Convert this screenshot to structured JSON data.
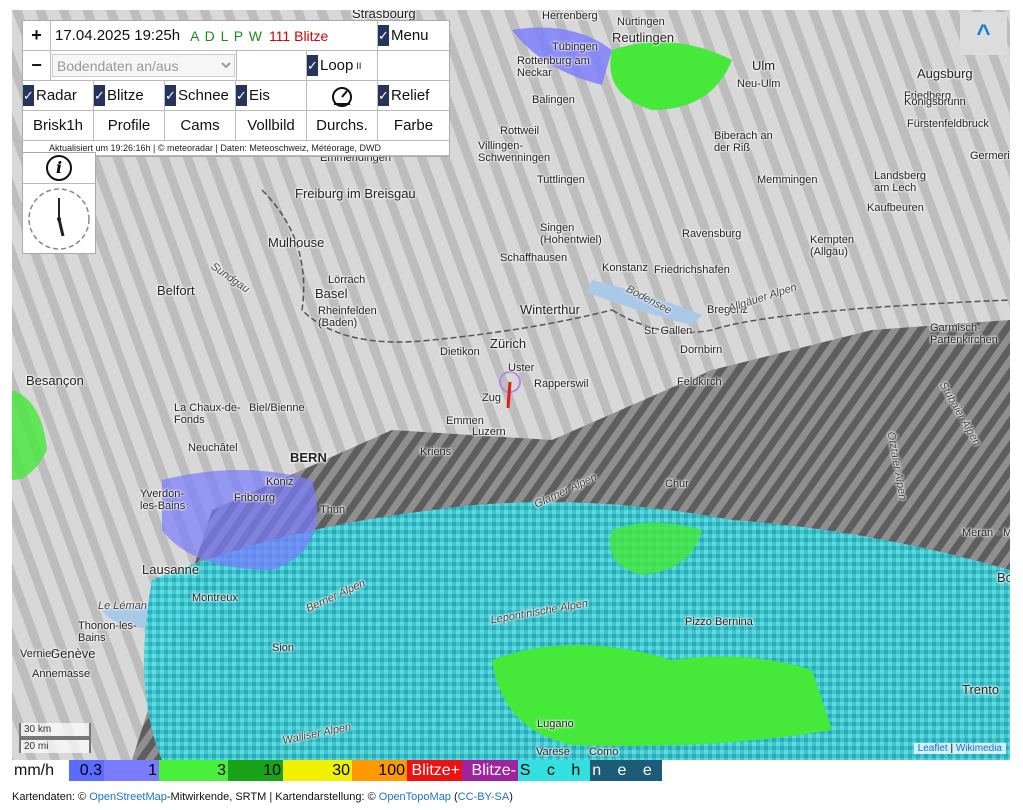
{
  "panel": {
    "zoom_in": "+",
    "zoom_out": "−",
    "datetime": "17.04.2025 19:25h",
    "network_letters": "A D L P W",
    "lightning_count": "111 Blitze",
    "menu_label": "Menu",
    "ground_data_placeholder": "Bodendaten an/aus",
    "loop_label": "Loop",
    "loop_pause_glyph": "II",
    "toggles": [
      {
        "label": "Radar",
        "checked": true
      },
      {
        "label": "Blitze",
        "checked": true
      },
      {
        "label": "Schnee",
        "checked": true
      },
      {
        "label": "Eis",
        "checked": true
      },
      {
        "label": "Relief",
        "checked": true
      }
    ],
    "buttons": [
      "Brisk1h",
      "Profile",
      "Cams",
      "Vollbild",
      "Durchs.",
      "Farbe"
    ],
    "status": "Aktualisiert um 19:26:16h | © meteoradar | Daten: Meteoschweiz, Météorage, DWD",
    "info_glyph": "i"
  },
  "expand_glyph": "^",
  "map": {
    "places": [
      {
        "name": "Strasbourg",
        "style": "big"
      },
      {
        "name": "Herrenberg"
      },
      {
        "name": "Nürtingen"
      },
      {
        "name": "Reutlingen",
        "style": "big"
      },
      {
        "name": "Tübingen"
      },
      {
        "name": "Rottenburg am Neckar"
      },
      {
        "name": "Balingen"
      },
      {
        "name": "Ulm",
        "style": "big"
      },
      {
        "name": "Neu-Ulm"
      },
      {
        "name": "Augsburg",
        "style": "big"
      },
      {
        "name": "Friedberg"
      },
      {
        "name": "Königsbrunn"
      },
      {
        "name": "Fürstenfeldbruck"
      },
      {
        "name": "Rottweil"
      },
      {
        "name": "Villingen-Schwenningen"
      },
      {
        "name": "Biberach an der Riß"
      },
      {
        "name": "Germering"
      },
      {
        "name": "Emmendingen"
      },
      {
        "name": "Tuttlingen"
      },
      {
        "name": "Memmingen"
      },
      {
        "name": "Landsberg am Lech"
      },
      {
        "name": "Kaufbeuren"
      },
      {
        "name": "Freiburg im Breisgau",
        "style": "big"
      },
      {
        "name": "Mulhouse",
        "style": "big"
      },
      {
        "name": "Singen (Hohentwiel)"
      },
      {
        "name": "Ravensburg"
      },
      {
        "name": "Kempten (Allgäu)"
      },
      {
        "name": "Schaffhausen"
      },
      {
        "name": "Konstanz"
      },
      {
        "name": "Friedrichshafen"
      },
      {
        "name": "Belfort",
        "style": "big"
      },
      {
        "name": "Lörrach"
      },
      {
        "name": "Basel",
        "style": "big"
      },
      {
        "name": "Rheinfelden (Baden)"
      },
      {
        "name": "Winterthur",
        "style": "big"
      },
      {
        "name": "Bregenz"
      },
      {
        "name": "St. Gallen"
      },
      {
        "name": "Garmisch-Partenkirchen"
      },
      {
        "name": "Dietikon"
      },
      {
        "name": "Zürich",
        "style": "big"
      },
      {
        "name": "Dornbirn"
      },
      {
        "name": "Uster"
      },
      {
        "name": "Rapperswil"
      },
      {
        "name": "Feldkirch"
      },
      {
        "name": "Besançon",
        "style": "big"
      },
      {
        "name": "La Chaux-de-Fonds"
      },
      {
        "name": "Biel/Bienne"
      },
      {
        "name": "Zug"
      },
      {
        "name": "Emmen"
      },
      {
        "name": "Luzern"
      },
      {
        "name": "Kriens"
      },
      {
        "name": "Neuchâtel"
      },
      {
        "name": "BERN",
        "style": "bold"
      },
      {
        "name": "Chur"
      },
      {
        "name": "Köniz"
      },
      {
        "name": "Yverdon-les-Bains"
      },
      {
        "name": "Fribourg"
      },
      {
        "name": "Thun"
      },
      {
        "name": "Meran - Merano"
      },
      {
        "name": "Lausanne",
        "style": "big"
      },
      {
        "name": "Le Léman",
        "style": "alps"
      },
      {
        "name": "Montreux"
      },
      {
        "name": "Thonon-les-Bains"
      },
      {
        "name": "Genève",
        "style": "big"
      },
      {
        "name": "Vernier"
      },
      {
        "name": "Annemasse"
      },
      {
        "name": "Lugano"
      },
      {
        "name": "Sion"
      },
      {
        "name": "Pizzo Bernina"
      },
      {
        "name": "Varese"
      },
      {
        "name": "Como"
      },
      {
        "name": "Trento"
      },
      {
        "name": "Bo"
      },
      {
        "name": "Allgäuer Alpen",
        "style": "alps"
      },
      {
        "name": "Stubaier Alpen",
        "style": "alps"
      },
      {
        "name": "Ötztaler Alpen",
        "style": "alps"
      },
      {
        "name": "Glarner Alpen",
        "style": "alps"
      },
      {
        "name": "Berner Alpen",
        "style": "alps"
      },
      {
        "name": "Walliser Alpen",
        "style": "alps"
      },
      {
        "name": "Lepontinische Alpen",
        "style": "alps"
      },
      {
        "name": "Bodensee",
        "style": "alps"
      },
      {
        "name": "Sundgau",
        "style": "alps"
      }
    ],
    "scale": {
      "metric": "30 km",
      "imperial": "20 mi"
    },
    "attribution": {
      "leaflet": "Leaflet",
      "sep": " | ",
      "wiki": "Wikimedia"
    }
  },
  "legend": {
    "unit": "mm/h",
    "segments": [
      {
        "label": "0.3",
        "color": "#5a6bff"
      },
      {
        "label": "1",
        "color": "#7b7bff"
      },
      {
        "label": "3",
        "color": "#48f03c"
      },
      {
        "label": "10",
        "color": "#19a319"
      },
      {
        "label": "30",
        "color": "#f0f000"
      },
      {
        "label": "100",
        "color": "#ff9900"
      },
      {
        "label": "Blitze+",
        "color": "#ee1111"
      },
      {
        "label": "Blitze-",
        "color": "#a0229f"
      },
      {
        "label": "S c h",
        "color": "#33e0e0"
      },
      {
        "label": "n e e",
        "color": "#1c5c78"
      }
    ]
  },
  "footer": {
    "prefix": "Kartendaten: © ",
    "osm": "OpenStreetMap",
    "mid": "-Mitwirkende, SRTM | Kartendarstellung: © ",
    "otm": "OpenTopoMap",
    "open_paren": " (",
    "license": "CC-BY-SA",
    "close_paren": ")"
  }
}
